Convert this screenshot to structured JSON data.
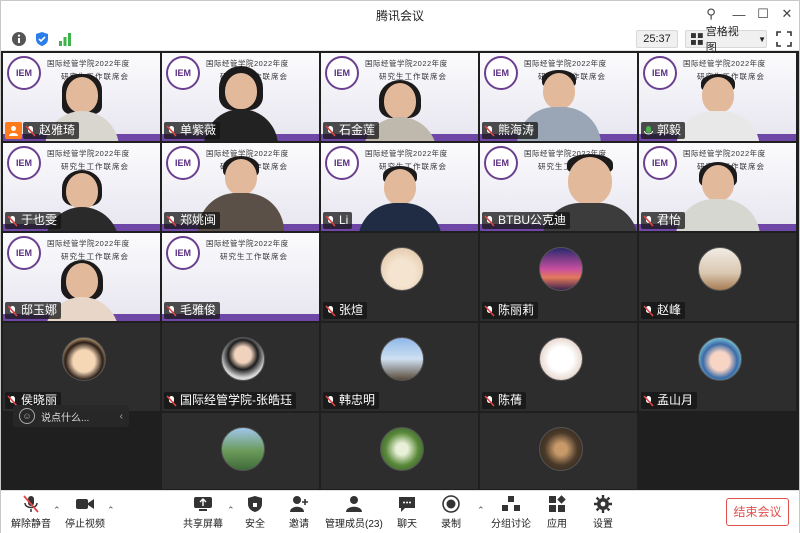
{
  "window": {
    "title": "腾讯会议"
  },
  "infobar": {
    "timer": "25:37",
    "grid_view_label": "宫格视图"
  },
  "slide": {
    "line1": "国际经管学院2022年度",
    "line2": "研究生工作联席会",
    "logo_text": "IEM"
  },
  "participants": [
    {
      "name": "赵雅琦"
    },
    {
      "name": "单紫薇"
    },
    {
      "name": "石金莲"
    },
    {
      "name": "熊海涛"
    },
    {
      "name": "郭毅"
    },
    {
      "name": "于也雯"
    },
    {
      "name": "郑姚闽"
    },
    {
      "name": "Li"
    },
    {
      "name": "BTBU公克迪"
    },
    {
      "name": "君怡"
    },
    {
      "name": "邸玉娜"
    },
    {
      "name": "毛雅俊"
    },
    {
      "name": "张煊"
    },
    {
      "name": "陈丽莉"
    },
    {
      "name": "赵峰"
    },
    {
      "name": "侯晓丽"
    },
    {
      "name": "国际经管学院-张皓珏"
    },
    {
      "name": "韩忠明"
    },
    {
      "name": "陈蒨"
    },
    {
      "name": "孟山月"
    }
  ],
  "chat": {
    "placeholder": "说点什么..."
  },
  "toolbar": {
    "unmute": "解除静音",
    "stop_video": "停止视频",
    "share_screen": "共享屏幕",
    "security": "安全",
    "invite": "邀请",
    "manage_members": "管理成员(23)",
    "chat": "聊天",
    "record": "录制",
    "breakout": "分组讨论",
    "apps": "应用",
    "settings": "设置",
    "end_meeting": "结束会议"
  },
  "colors": {
    "accent_green": "#4caf50",
    "end_red": "#e0514f",
    "host_orange": "#ff7a1a",
    "slide_purple": "#6f48a7"
  }
}
